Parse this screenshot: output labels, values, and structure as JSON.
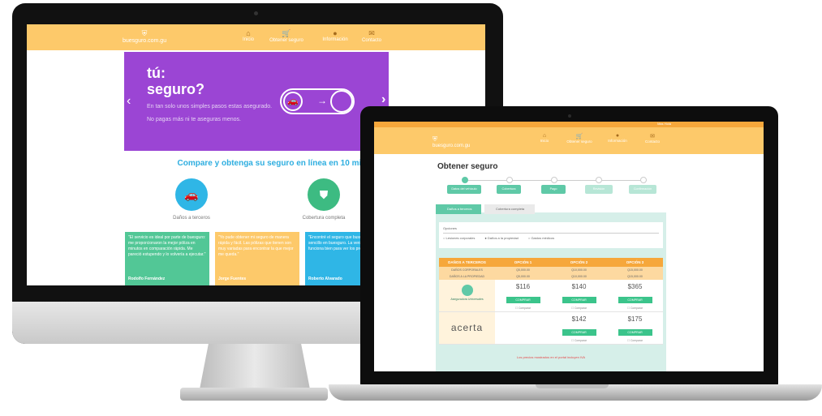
{
  "desktop": {
    "logo_text": "buesguro.com.gu",
    "nav": [
      {
        "label": "Inicio",
        "icon": "home-icon"
      },
      {
        "label": "Obtener seguro",
        "icon": "cart-icon"
      },
      {
        "label": "Información",
        "icon": "user-icon"
      },
      {
        "label": "Contacto",
        "icon": "mail-icon"
      }
    ],
    "hero": {
      "title_line1": "tú:",
      "title_line2": "seguro?",
      "line1": "En tan solo unos simples pasos estas asegurado.",
      "line2": "No pagas más ni te aseguras menos."
    },
    "tagline": "Compare y obtenga su seguro en línea en 10 minutos",
    "features": [
      {
        "label": "Daños a terceros",
        "color": "#2fb6e6",
        "icon": "car-icon"
      },
      {
        "label": "Cobertura completa",
        "color": "#3dbb82",
        "icon": "shield-icon"
      }
    ],
    "cards": [
      {
        "text": "\"El servicio es ideal por parte de buesguro: me proporcionaron la mejor póliza en minutos en comparación rápida. Me pareció estupendo y lo volvería a ejecutar.\"",
        "author": "Rodolfo Fernández",
        "color": "#52c796"
      },
      {
        "text": "\"Yo pude obtener mi seguro de manera rápida y fácil. Las pólizas que tienen son muy variadas para encontrar la que mejor me queda.\"",
        "author": "Jorge Fuentes",
        "color": "#fdc96a"
      },
      {
        "text": "\"Encontré el seguro que buscaba rápido y sencillo en buesguro. La verdad es que funciona bien para ver los precios.\"",
        "author": "Roberto Alvarado",
        "color": "#2fb6e6"
      }
    ]
  },
  "laptop": {
    "top_right": "Mas Hola",
    "logo_text": "buesguro.com.gu",
    "nav": [
      {
        "label": "Inicio",
        "icon": "home-icon"
      },
      {
        "label": "Obtener seguro",
        "icon": "cart-icon"
      },
      {
        "label": "Información",
        "icon": "user-icon"
      },
      {
        "label": "Contacto",
        "icon": "mail-icon"
      }
    ],
    "page_title": "Obtener seguro",
    "steps": [
      {
        "label": "Datos del vehículo",
        "active": true
      },
      {
        "label": "Cobertura",
        "active": true
      },
      {
        "label": "Pago",
        "active": true
      },
      {
        "label": "Revisión",
        "active": false
      },
      {
        "label": "Confirmación",
        "active": false
      }
    ],
    "tabs": [
      {
        "label": "Daños a terceros"
      },
      {
        "label": "Cobertura completa"
      }
    ],
    "options_title": "Opciones",
    "options": [
      "Lesiones corporales",
      "Daños a la propiedad",
      "Gastos médicos"
    ],
    "table": {
      "headers": [
        "DAÑOS A TERCEROS",
        "OPCIÓN 1",
        "OPCIÓN 2",
        "OPCIÓN 3"
      ],
      "sub1": [
        "DAÑOS CORPORALES",
        "Q5,000.00",
        "Q10,000.00",
        "Q15,000.00"
      ],
      "sub2": [
        "DAÑOS A LA PROPIEDAD",
        "Q5,000.00",
        "Q10,000.00",
        "Q15,000.00"
      ],
      "insurers": [
        {
          "name": "Aseguradora Universales",
          "prices": [
            "$116",
            "$140",
            "$365"
          ]
        },
        {
          "name": "acerta",
          "prices": [
            "",
            "$142",
            "$175"
          ]
        }
      ],
      "buy_label": "COMPRAR",
      "compare_label": "Comparar"
    },
    "footer_note": "Los precios mostrados en el portal incluyen IVA"
  }
}
